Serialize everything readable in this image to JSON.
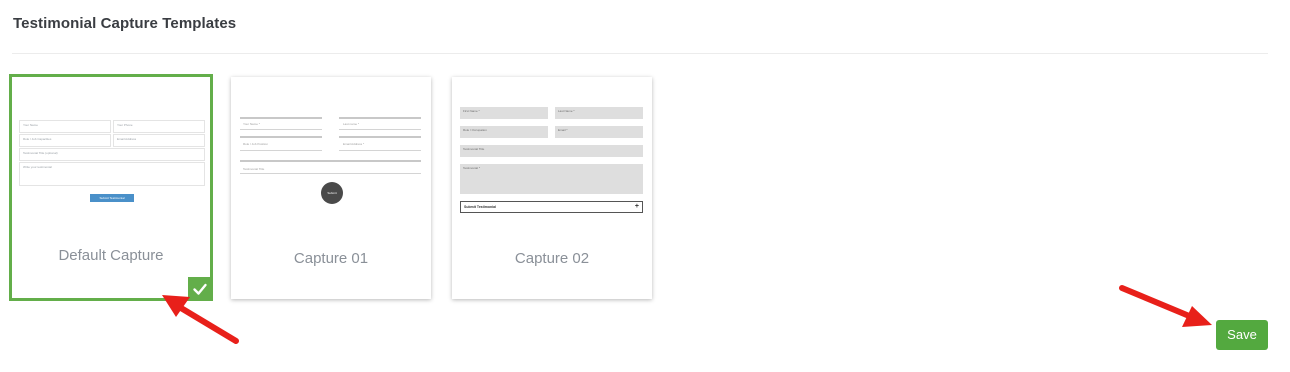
{
  "section": {
    "title": "Testimonial Capture Templates"
  },
  "templates": [
    {
      "label": "Default Capture",
      "selected": true,
      "preview": {
        "fields": [
          "Your Name",
          "Your Phone",
          "Role / Job Capacities",
          "Email Address",
          "Testimonial Title (optional)",
          "Write your testimonial"
        ],
        "submit": "Submit Testimonial"
      }
    },
    {
      "label": "Capture 01",
      "selected": false,
      "preview": {
        "fields": [
          "Your Name *",
          "Last name *",
          "Role / Job Position",
          "Email Address *",
          "Testimonial Title"
        ],
        "submit": "Submit"
      }
    },
    {
      "label": "Capture 02",
      "selected": false,
      "preview": {
        "fields": [
          "First Name *",
          "Last Name *",
          "Role / Occupation",
          "Email *",
          "Testimonial Title",
          "Testimonial *"
        ],
        "submit": "Submit Testimonial",
        "submit_icon": "+"
      }
    }
  ],
  "selected_badge": {
    "icon": "check-icon",
    "color": "#63ae4a"
  },
  "actions": {
    "save_label": "Save",
    "save_color": "#53a93f"
  },
  "annotations": {
    "arrow_icon": "red-arrow-icon",
    "arrow_color": "#e8201a"
  }
}
